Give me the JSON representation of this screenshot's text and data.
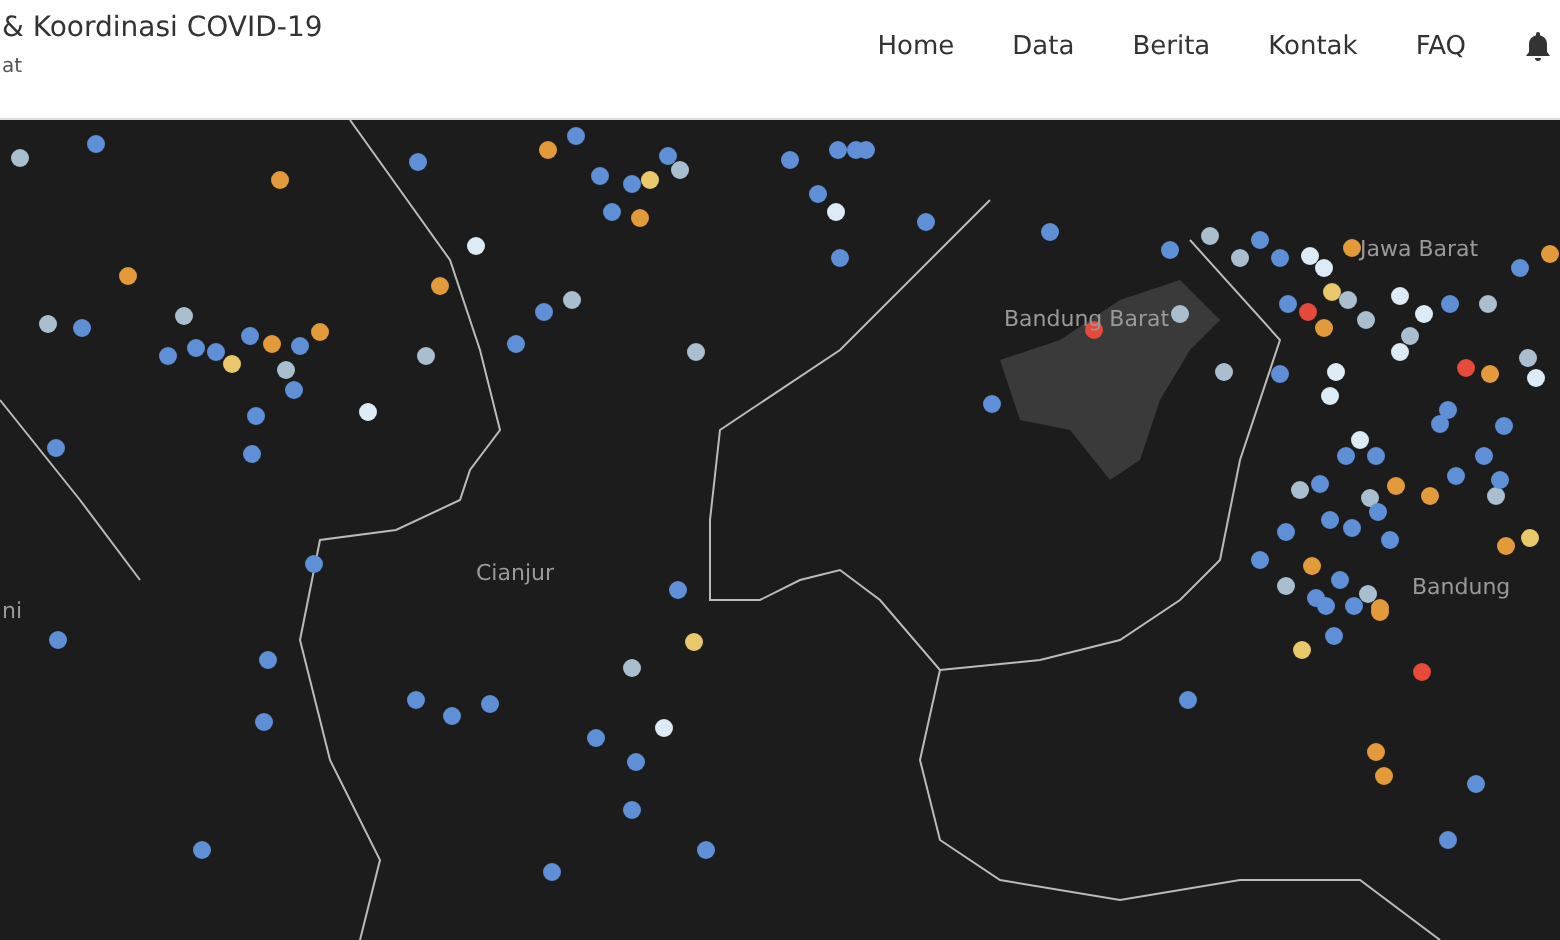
{
  "header": {
    "title": "& Koordinasi COVID-19",
    "subtitle": "at"
  },
  "nav": [
    {
      "label": "Home"
    },
    {
      "label": "Data"
    },
    {
      "label": "Berita"
    },
    {
      "label": "Kontak"
    },
    {
      "label": "FAQ"
    }
  ],
  "map": {
    "labels": [
      "Bandung Barat",
      "Jawa Barat",
      "Cianjur",
      "Bandung",
      "ni"
    ]
  }
}
